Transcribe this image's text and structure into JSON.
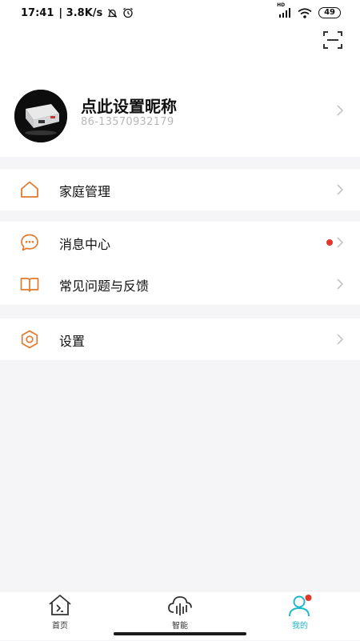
{
  "status_bar": {
    "time": "17:41",
    "net_speed": "| 3.8K/s",
    "network": "HD",
    "battery": "49"
  },
  "profile": {
    "nickname": "点此设置昵称",
    "phone": "86-13570932179"
  },
  "menu": {
    "family": "家庭管理",
    "messages": "消息中心",
    "faq": "常见问题与反馈",
    "settings": "设置"
  },
  "tabs": {
    "home": "首页",
    "smart": "智能",
    "mine": "我的"
  },
  "colors": {
    "accent_orange": "#e07a2f",
    "active_tab": "#1bb8c9",
    "badge_red": "#e0382a"
  }
}
